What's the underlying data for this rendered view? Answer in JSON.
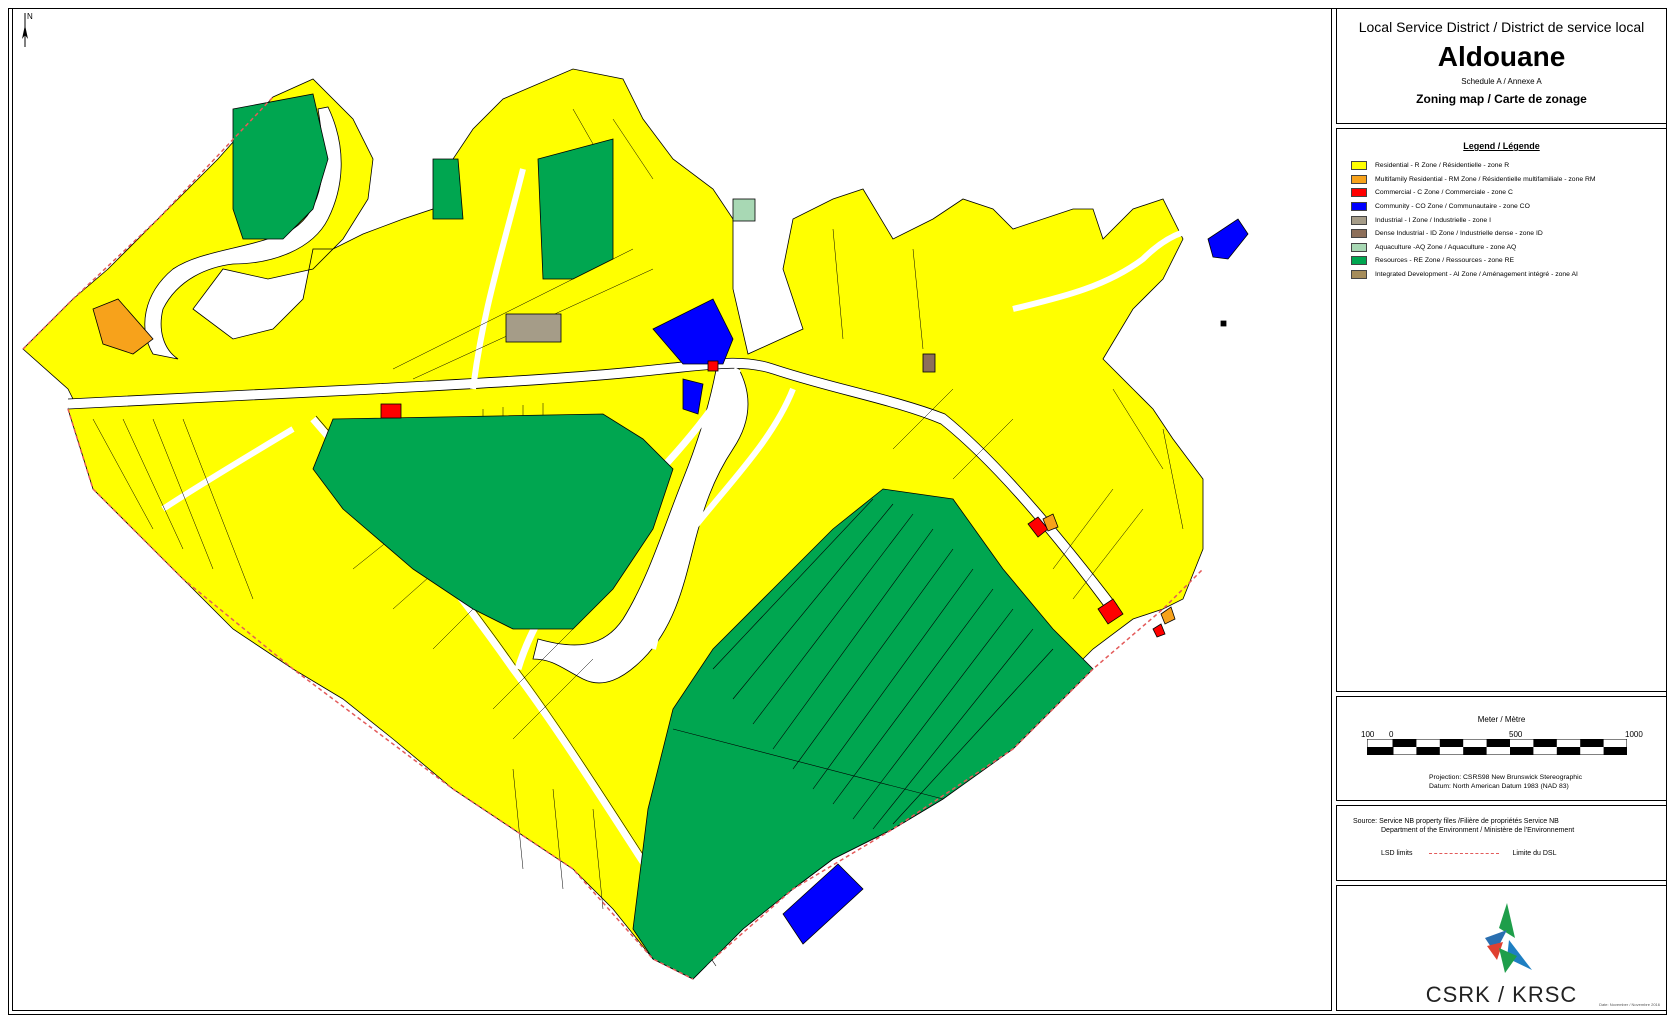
{
  "title": {
    "lsd_label": "Local Service District / District de service local",
    "name": "Aldouane",
    "schedule": "Schedule A / Annexe A",
    "map_title": "Zoning map / Carte de zonage"
  },
  "legend": {
    "heading": "Legend / Légende",
    "items": [
      {
        "label": "Residential - R Zone / Résidentielle - zone R",
        "color": "#ffff00"
      },
      {
        "label": "Multifamily Residential - RM Zone / Résidentielle multifamiliale - zone RM",
        "color": "#f7a21b"
      },
      {
        "label": "Commercial - C Zone / Commerciale - zone C",
        "color": "#ff0000"
      },
      {
        "label": "Community - CO Zone / Communautaire - zone CO",
        "color": "#0000ff"
      },
      {
        "label": "Industrial - I Zone / Industrielle - zone I",
        "color": "#a59c88"
      },
      {
        "label": "Dense Industrial - ID Zone / Industrielle dense - zone ID",
        "color": "#8d6f5a"
      },
      {
        "label": "Aquaculture -AQ Zone / Aquaculture - zone AQ",
        "color": "#a8d8b4"
      },
      {
        "label": "Resources - RE Zone / Ressources - zone RE",
        "color": "#00a650"
      },
      {
        "label": "Integrated Development - AI Zone / Aménagement intégré - zone AI",
        "color": "#a58c5a"
      }
    ]
  },
  "scale": {
    "title": "Meter / Mètre",
    "labels": [
      "100",
      "0",
      "500",
      "1000"
    ],
    "projection": "Projection: CSRS98 New Brunswick Stereographic",
    "datum": "Datum: North American Datum 1983 (NAD 83)"
  },
  "source": {
    "label": "Source:",
    "line1": "Service NB property files /Filière de propriétés Service NB",
    "line2": "Department of the Environment  / Ministère de l'Environnement",
    "lsd_limits": "LSD limits",
    "limite": "Limite du DSL"
  },
  "logo": {
    "text": "CSRK / KRSC",
    "date": "Date: November / Novembre 2016"
  },
  "north": "N"
}
